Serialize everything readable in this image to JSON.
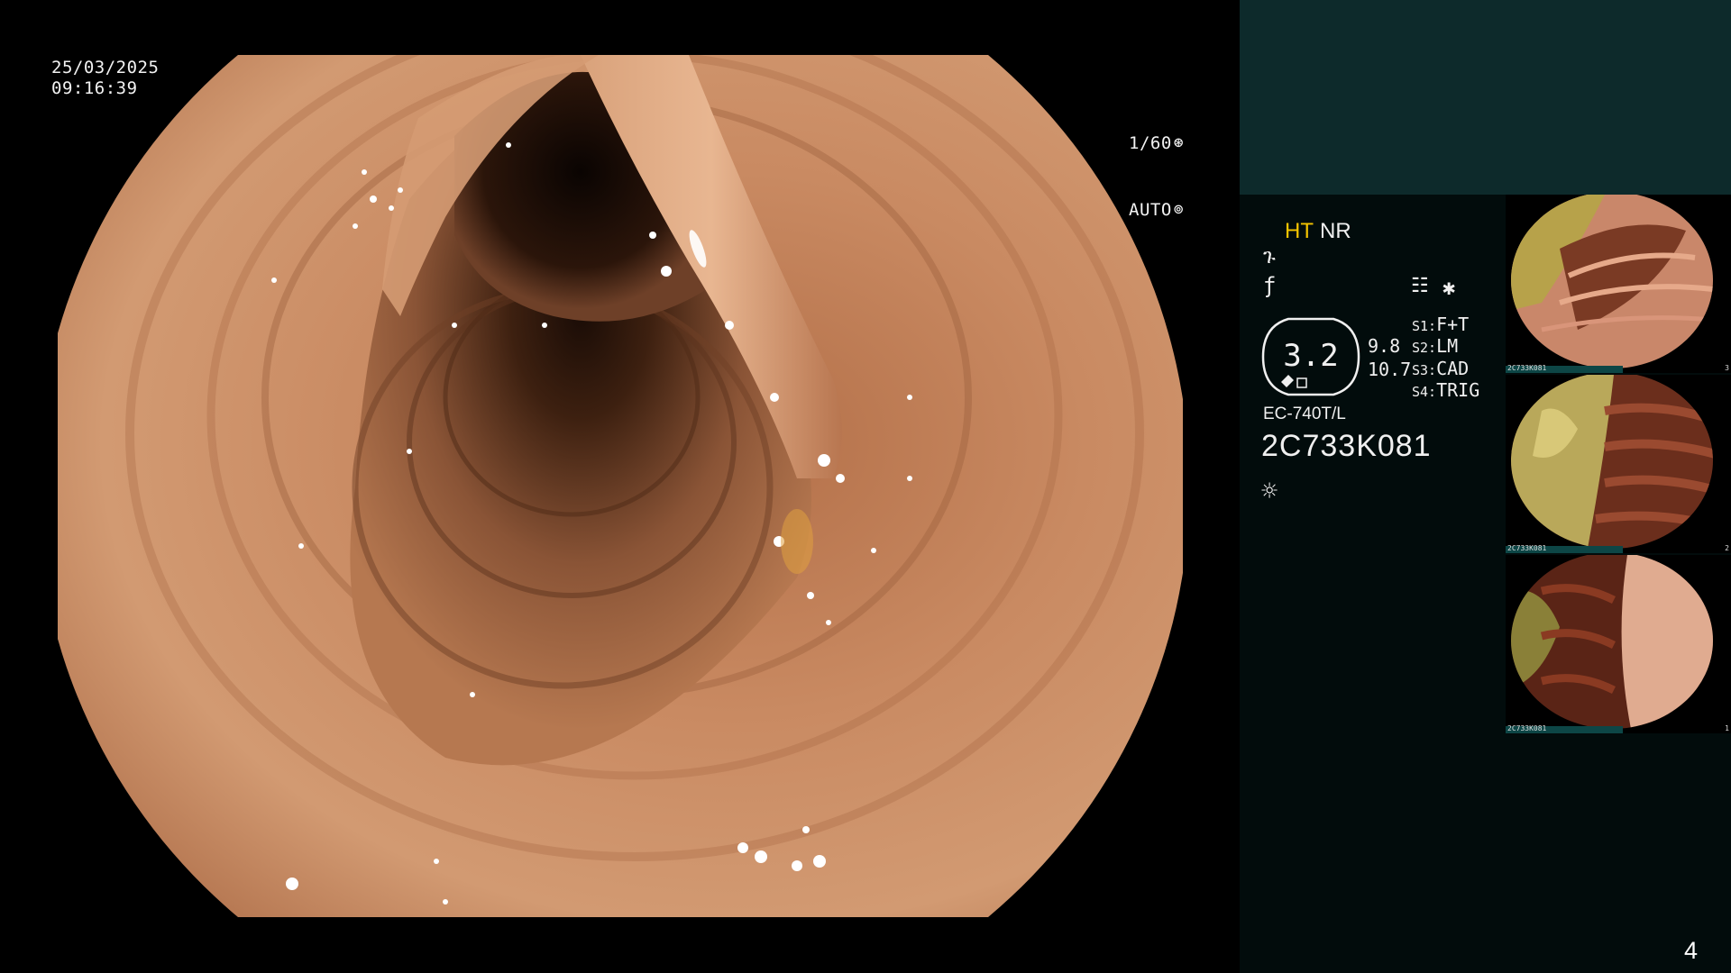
{
  "overlay": {
    "date": "25/03/2025",
    "time": "09:16:39",
    "shutter_speed": "1/60",
    "shutter_mode": "AUTO"
  },
  "panel": {
    "mode_ht": "HT",
    "mode_nr": "NR",
    "zoom": "3.2",
    "value_a": "9.8",
    "value_b": "10.7",
    "presets": [
      {
        "key": "S1:",
        "label": "F+T"
      },
      {
        "key": "S2:",
        "label": "LM"
      },
      {
        "key": "S3:",
        "label": "CAD"
      },
      {
        "key": "S4:",
        "label": "TRIG"
      }
    ],
    "scope_model": "EC-740T/L",
    "scope_serial": "2C733K081"
  },
  "thumbnails": [
    {
      "caption": "2C733K081",
      "index": "3"
    },
    {
      "caption": "2C733K081",
      "index": "2"
    },
    {
      "caption": "2C733K081",
      "index": "1"
    }
  ],
  "page_number": "4",
  "colors": {
    "panel_bg": "#020c0c",
    "panel_top_bg": "#0d2a2b",
    "highlight": "#f5c400"
  },
  "icons": [
    "shutter-icon",
    "auto-iris-icon",
    "curve-icon",
    "filter-icon",
    "menu-icon",
    "star-icon",
    "light-source-icon"
  ]
}
